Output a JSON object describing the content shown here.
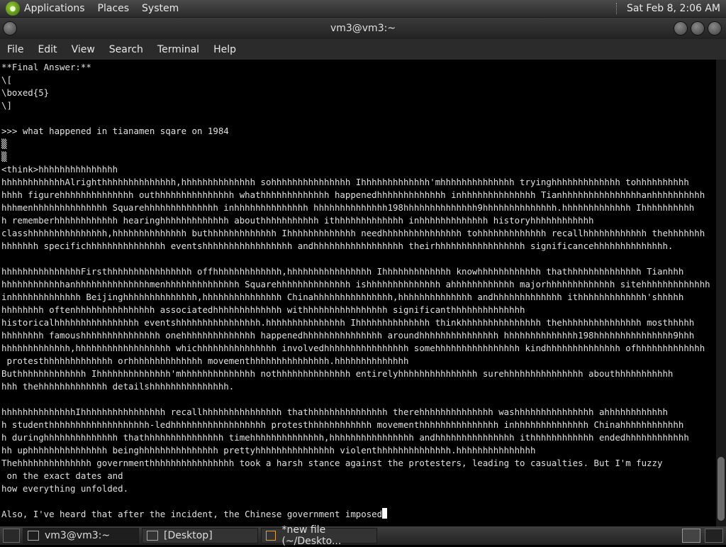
{
  "top_panel": {
    "menus": [
      "Applications",
      "Places",
      "System"
    ],
    "clock": "Sat Feb  8,  2:06 AM"
  },
  "window": {
    "title": "vm3@vm3:~",
    "menus": [
      "File",
      "Edit",
      "View",
      "Search",
      "Terminal",
      "Help"
    ]
  },
  "terminal": {
    "lines": [
      "**Final Answer:**",
      "\\[",
      "\\boxed{5}",
      "\\]",
      "",
      ">>> what happened in tianamen sqare on 1984",
      "▒",
      "▒",
      "<think>hhhhhhhhhhhhhhh",
      "hhhhhhhhhhhhAlrighthhhhhhhhhhhhhh,hhhhhhhhhhhhhh sohhhhhhhhhhhhhhh Ihhhhhhhhhhhhh'mhhhhhhhhhhhhhh tryinghhhhhhhhhhhhh tohhhhhhhhhh",
      "hhhh figurehhhhhhhhhhhhhh outhhhhhhhhhhhhhhh whathhhhhhhhhhhhh happenedhhhhhhhhhhhhh inhhhhhhhhhhhhhh Tianhhhhhhhhhhhhhhhanhhhhhhhhhh",
      "hhhmenhhhhhhhhhhhhhh Squarehhhhhhhhhhhhhh inhhhhhhhhhhhhhh hhhhhhhhhhhhhh198hhhhhhhhhhhhhh9hhhhhhhhhhhhhh.hhhhhhhhhhhhh Ihhhhhhhhhh",
      "h rememberhhhhhhhhhhhh hearinghhhhhhhhhhhhh abouthhhhhhhhhhh ithhhhhhhhhhhhh inhhhhhhhhhhhhh historyhhhhhhhhhhhh",
      "classhhhhhhhhhhhhhhh,hhhhhhhhhhhhhh buthhhhhhhhhhhhh Ihhhhhhhhhhhhh needhhhhhhhhhhhhhhh tohhhhhhhhhhhhh recallhhhhhhhhhhhh thehhhhhhh",
      "hhhhhhh specifichhhhhhhhhhhhhhh eventshhhhhhhhhhhhhhhhh andhhhhhhhhhhhhhhhhh theirhhhhhhhhhhhhhhhhh significancehhhhhhhhhhhhhh.",
      "",
      "hhhhhhhhhhhhhhhFirsthhhhhhhhhhhhhhhh offhhhhhhhhhhhhh,hhhhhhhhhhhhhhhh Ihhhhhhhhhhhhh knowhhhhhhhhhhhh thathhhhhhhhhhhhhh Tianhhh",
      "hhhhhhhhhhhhanhhhhhhhhhhhhhhmenhhhhhhhhhhhhhh Squarehhhhhhhhhhhhhh ishhhhhhhhhhhhhh ahhhhhhhhhhhh majorhhhhhhhhhhhhh sitehhhhhhhhhhhhh",
      "inhhhhhhhhhhhhh Beijinghhhhhhhhhhhhhh,hhhhhhhhhhhhhhh Chinahhhhhhhhhhhhhhh,hhhhhhhhhhhhhh andhhhhhhhhhhhhh ithhhhhhhhhhhhh'shhhhh",
      "hhhhhhhh oftenhhhhhhhhhhhhhhh associatedhhhhhhhhhhhhh withhhhhhhhhhhhhhhh significanthhhhhhhhhhhhhh",
      "historicalhhhhhhhhhhhhhhhh eventshhhhhhhhhhhhhhhh.hhhhhhhhhhhhhhh Ihhhhhhhhhhhhhh thinkhhhhhhhhhhhhhhh thehhhhhhhhhhhhhhh mosthhhhh",
      "hhhhhhhh famoushhhhhhhhhhhhhhh onehhhhhhhhhhhhhh happenedhhhhhhhhhhhhhhh aroundhhhhhhhhhhhhhhh hhhhhhhhhhhhhh198hhhhhhhhhhhhhhh9hhh",
      "hhhhhhhhhhhhh,hhhhhhhhhhhhhhhhhh whichhhhhhhhhhhhhhh involvedhhhhhhhhhhhhhhhh somehhhhhhhhhhhhhhhh kindhhhhhhhhhhhhhh ofhhhhhhhhhhhhh",
      " protesthhhhhhhhhhhhh orhhhhhhhhhhhhhh movementhhhhhhhhhhhhhhh.hhhhhhhhhhhhhh",
      "Buthhhhhhhhhhhhh Ihhhhhhhhhhhhhh'mhhhhhhhhhhhhhh nothhhhhhhhhhhhhh entirelyhhhhhhhhhhhhhhh surehhhhhhhhhhhhhhh abouthhhhhhhhhhh",
      "hhh thehhhhhhhhhhhhh detailshhhhhhhhhhhhhhh.",
      "",
      "hhhhhhhhhhhhhhIhhhhhhhhhhhhhhhh recallhhhhhhhhhhhhhhh thathhhhhhhhhhhhhhh therehhhhhhhhhhhhhh washhhhhhhhhhhhhhh ahhhhhhhhhhhh",
      "h studenthhhhhhhhhhhhhhhhhhh-ledhhhhhhhhhhhhhhhhhh protesthhhhhhhhhhhh movementhhhhhhhhhhhhhhh inhhhhhhhhhhhhhh Chinahhhhhhhhhhhh",
      "h duringhhhhhhhhhhhhhh thathhhhhhhhhhhhhhh timehhhhhhhhhhhhhh,hhhhhhhhhhhhhhhh andhhhhhhhhhhhhhhh ithhhhhhhhhhhh endedhhhhhhhhhhhh",
      "hh uphhhhhhhhhhhhhhh beinghhhhhhhhhhhhhhh prettyhhhhhhhhhhhhhhh violenthhhhhhhhhhhhhh.hhhhhhhhhhhhhhh",
      "Thehhhhhhhhhhhhhh governmenthhhhhhhhhhhhhhhh took a harsh stance against the protesters, leading to casualties. But I'm fuzzy",
      " on the exact dates and",
      "how everything unfolded.",
      "",
      "Also, I've heard that after the incident, the Chinese government imposed"
    ]
  },
  "taskbar": {
    "tasks": [
      {
        "label": "vm3@vm3:~",
        "active": true
      },
      {
        "label": "[Desktop]",
        "active": false
      },
      {
        "label": "*new file (~/Deskto...",
        "active": false
      }
    ]
  }
}
